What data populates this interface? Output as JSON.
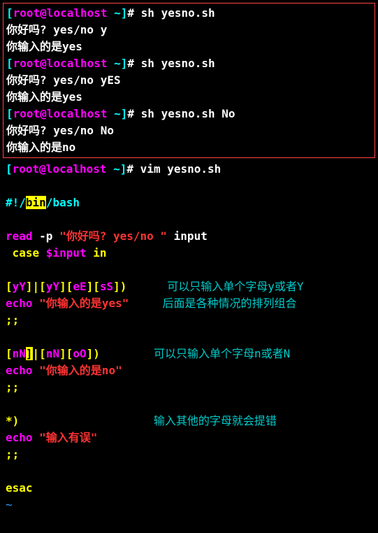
{
  "terminal": {
    "prompt_open": "[",
    "prompt_user": "root@localhost",
    "prompt_path": " ~",
    "prompt_close": "]",
    "prompt_hash": "# ",
    "cmd1": "sh yesno.sh",
    "q1": "你好吗? yes/no y",
    "a1": "你输入的是yes",
    "cmd2": "sh yesno.sh",
    "q2": "你好吗? yes/no yES",
    "a2": "你输入的是yes",
    "cmd3": "sh yesno.sh No",
    "q3": "你好吗? yes/no No",
    "a3": "你输入的是no",
    "cmd4": "vim yesno.sh"
  },
  "script": {
    "shebang_pre": "#!/",
    "shebang_bin": "bin",
    "shebang_post": "/bash",
    "read_kw": "read",
    "read_flag": " -p ",
    "read_str": "\"你好吗? yes/no \"",
    "read_var": " input",
    "case_kw": " case ",
    "case_var": "$input",
    "case_in": " in",
    "pat_y_1": "[",
    "pat_y_2": "yY",
    "pat_y_3": "]|[",
    "pat_y_4": "yY",
    "pat_y_5": "][",
    "pat_y_6": "eE",
    "pat_y_7": "][",
    "pat_y_8": "sS",
    "pat_y_9": "])",
    "comment_y1": "可以只输入单个字母y或者Y",
    "echo_y": "echo ",
    "echo_y_str": "\"你输入的是yes\"",
    "comment_y2": "后面是各种情况的排列组合",
    "dsemi": ";;",
    "pat_n_1": "[",
    "pat_n_2": "nN",
    "pat_n_3": "]",
    "pat_n_4": "|[",
    "pat_n_5": "nN",
    "pat_n_6": "][",
    "pat_n_7": "oO",
    "pat_n_8": "])",
    "comment_n": "可以只输入单个字母n或者N",
    "echo_n": "echo ",
    "echo_n_str": "\"你输入的是no\"",
    "pat_star": "*)",
    "comment_star": "输入其他的字母就会提错",
    "echo_star": "echo ",
    "echo_star_str": "\"输入有误\"",
    "esac": "esac",
    "tilde": "~"
  }
}
